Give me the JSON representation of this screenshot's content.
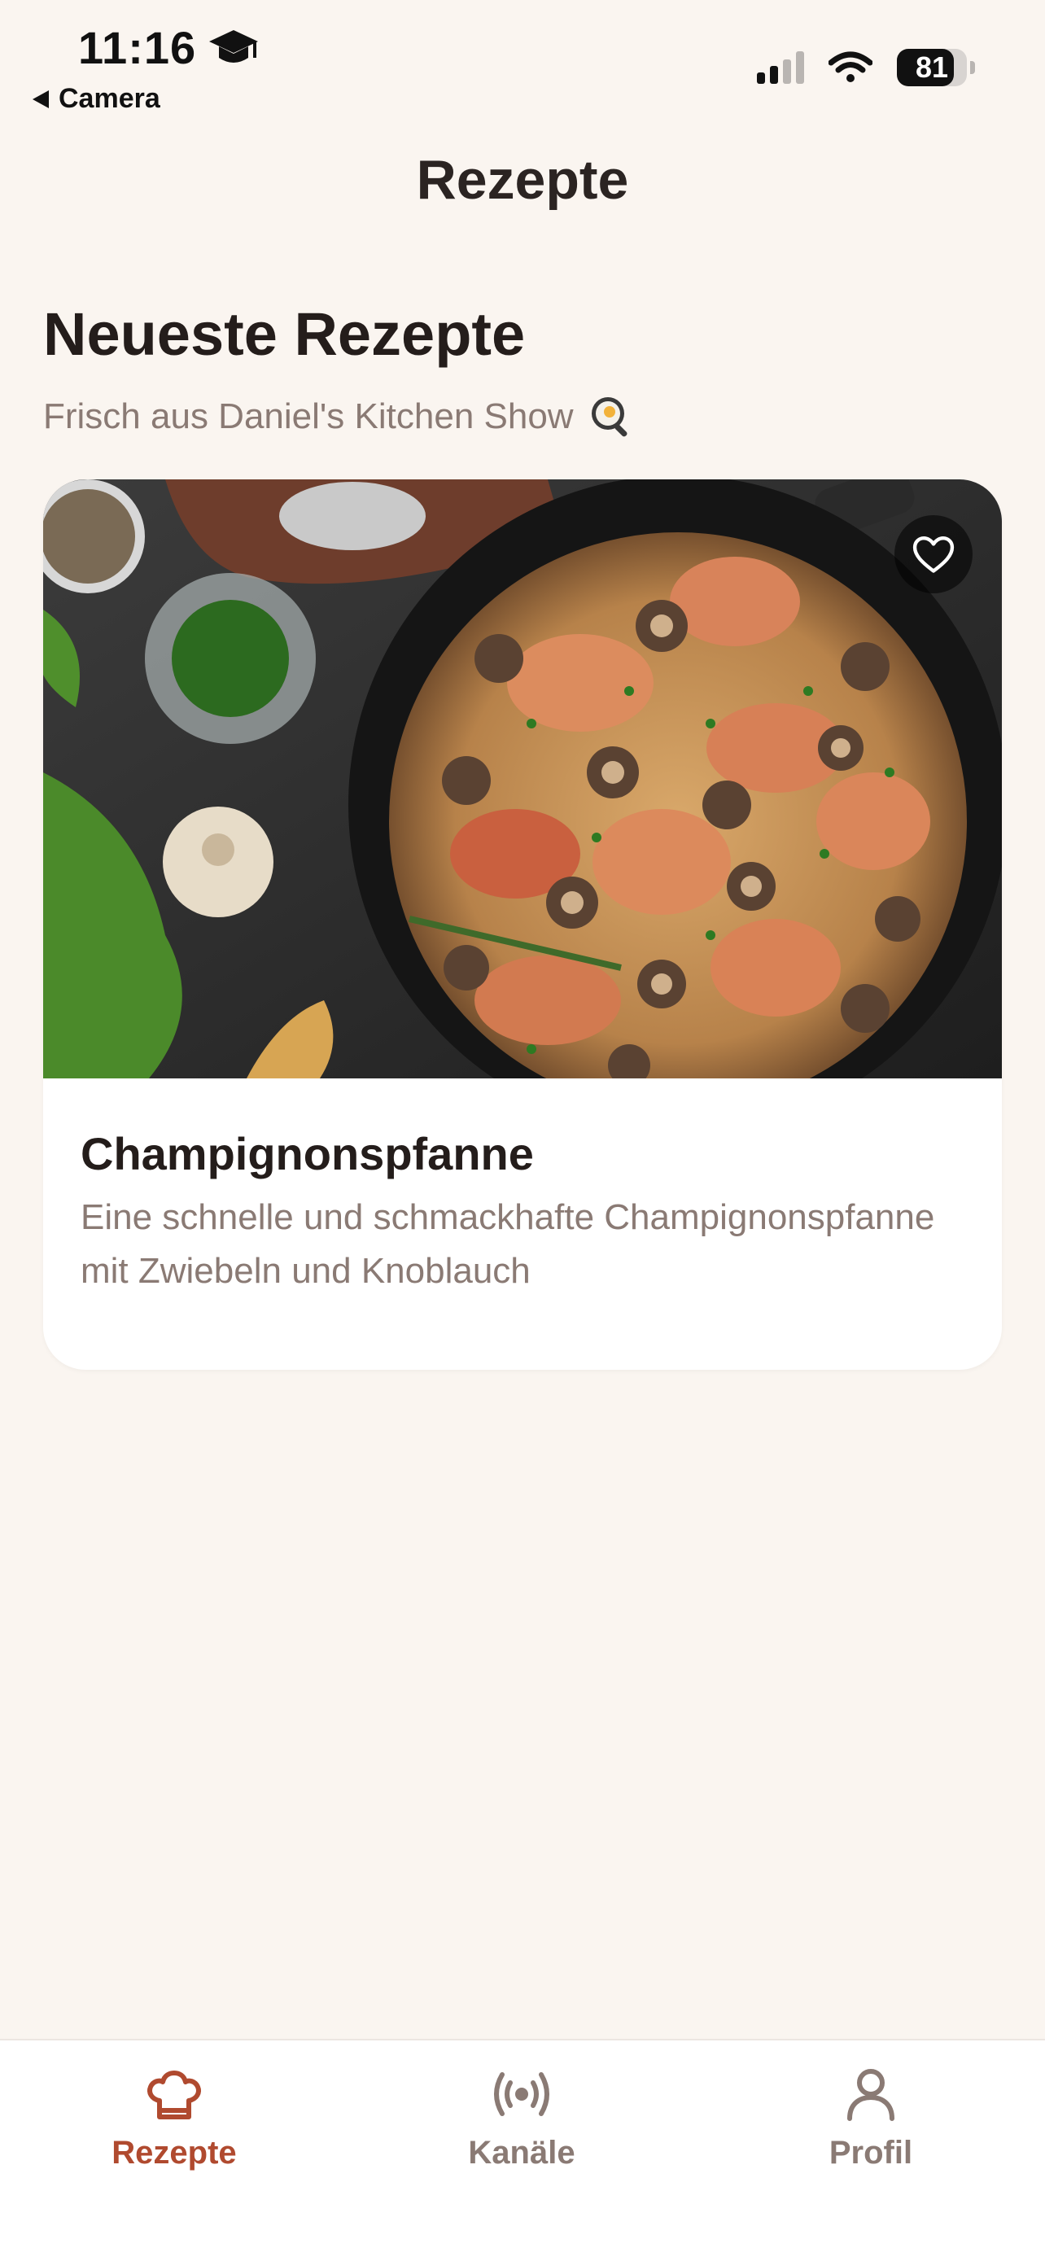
{
  "status_bar": {
    "time": "11:16",
    "back_label": "Camera",
    "battery": "81",
    "battery_fraction": 0.81
  },
  "header": {
    "title": "Rezepte"
  },
  "section": {
    "title": "Neueste Rezepte",
    "subtitle": "Frisch aus Daniel's Kitchen Show"
  },
  "recipe_card": {
    "title": "Champignonspfanne",
    "description": "Eine schnelle und schmackhafte Champignonspfanne mit Zwiebeln und Knoblauch",
    "favorite_icon": "heart-outline-icon"
  },
  "tabbar": {
    "tabs": [
      {
        "label": "Rezepte",
        "icon": "chef-hat-icon",
        "active": true
      },
      {
        "label": "Kanäle",
        "icon": "broadcast-icon",
        "active": false
      },
      {
        "label": "Profil",
        "icon": "person-icon",
        "active": false
      }
    ]
  },
  "colors": {
    "background": "#faf5f0",
    "accent": "#b04a2f",
    "muted_text": "#8a7a74",
    "dark_text": "#241d1b"
  }
}
